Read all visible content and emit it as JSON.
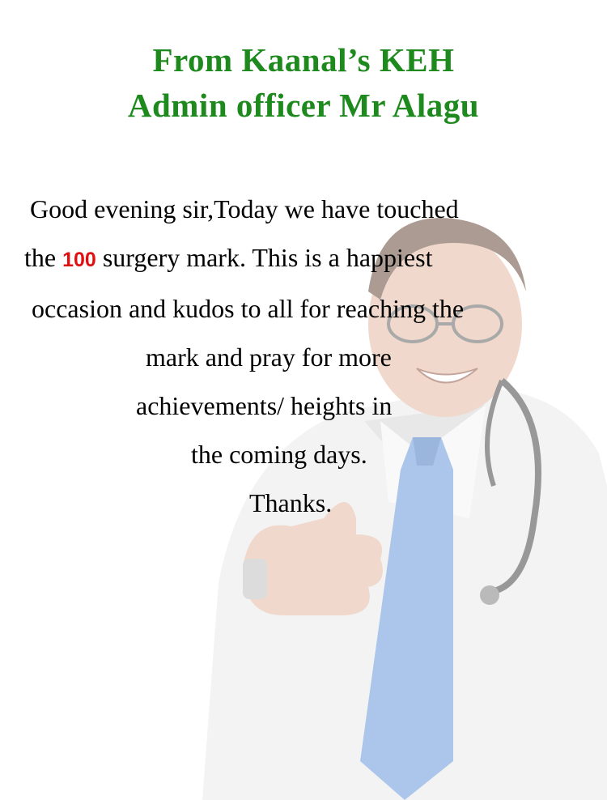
{
  "heading": {
    "line1": "From Kaanal’s KEH",
    "line2": "Admin officer Mr Alagu"
  },
  "message": {
    "line1": "Good evening sir,Today we have touched",
    "line2_before": "the",
    "highlight_number": "100",
    "line2_after": "surgery mark. This is a happiest",
    "line3": "occasion and kudos to all for reaching the",
    "line4": "mark and pray for more",
    "line5": "achievements/ heights in",
    "line6": "the coming days.",
    "sign_off": "Thanks."
  },
  "colors": {
    "heading": "#1e8a1e",
    "highlight": "#e01010",
    "body_text": "#000000"
  },
  "background_image": "doctor-thumbs-up-illustration"
}
